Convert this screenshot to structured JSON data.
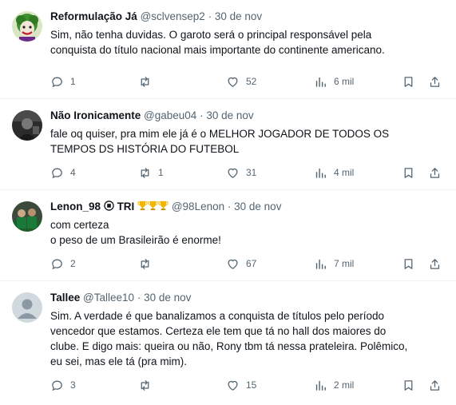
{
  "tweets": [
    {
      "name": "Reformulação Já",
      "handle": "@sclvensep2",
      "dot": "·",
      "date": "30 de nov",
      "text": "Sim, não tenha duvidas. O garoto será o principal responsável pela\nconquista do título nacional mais importante do continente americano.",
      "replies": "1",
      "retweets": "",
      "likes": "52",
      "views": "6 mil",
      "avatar": "joker-avatar"
    },
    {
      "name": "Não Ironicamente",
      "handle": "@gabeu04",
      "dot": "·",
      "date": "30 de nov",
      "text": "fale oq quiser, pra mim ele já é o MELHOR JOGADOR DE TODOS OS\nTEMPOS DS HISTÓRIA DO FUTEBOL",
      "replies": "4",
      "retweets": "1",
      "likes": "31",
      "views": "4 mil",
      "avatar": "dark-photo-avatar"
    },
    {
      "name": "Lenon_98",
      "name_suffix": "TRI",
      "handle": "@98Lenon",
      "dot": "·",
      "date": "30 de nov",
      "text": "com certeza\no peso de um Brasileirão é enorme!",
      "replies": "2",
      "retweets": "",
      "likes": "67",
      "views": "7 mil",
      "avatar": "team-photo-avatar"
    },
    {
      "name": "Tallee",
      "handle": "@Tallee10",
      "dot": "·",
      "date": "30 de nov",
      "text": "Sim. A verdade é que banalizamos a conquista de títulos pelo período\nvencedor que estamos. Certeza ele tem que tá no hall dos maiores do\nclube. E digo mais: queira ou não, Rony tbm tá nessa prateleira. Polêmico,\neu sei, mas ele tá (pra mim).",
      "replies": "3",
      "retweets": "",
      "likes": "15",
      "views": "2 mil",
      "avatar": "default-avatar"
    }
  ],
  "colors": {
    "text": "#0f1419",
    "secondary": "#536471",
    "divider": "#eff3f4",
    "trophy": "#f5b400"
  }
}
